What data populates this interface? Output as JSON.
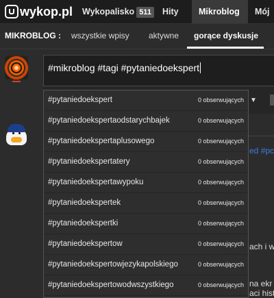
{
  "topbar": {
    "logo_text": "wykop.pl",
    "nav": [
      {
        "label": "Wykopalisko",
        "badge": "511"
      },
      {
        "label": "Hity"
      },
      {
        "label": "Mikroblog"
      },
      {
        "label": "Mój W"
      }
    ]
  },
  "subnav": {
    "label": "MIKROBLOG :",
    "items": [
      "wszystkie wpisy",
      "aktywne",
      "gorące dyskusje"
    ],
    "active": "gorące dyskusje"
  },
  "composer": {
    "value": "#mikroblog #tagi #pytaniedoekspert"
  },
  "suggestions": [
    {
      "tag": "#pytaniedoekspert",
      "count": "0 obserwujących"
    },
    {
      "tag": "#pytaniedoekspertaodstarychbajek",
      "count": "0 obserwujących"
    },
    {
      "tag": "#pytaniedoekspertaplusowego",
      "count": "0 obserwujących"
    },
    {
      "tag": "#pytaniedoekspertatery",
      "count": "0 obserwujących"
    },
    {
      "tag": "#pytaniedoekspertawypoku",
      "count": "0 obserwujących"
    },
    {
      "tag": "#pytaniedoekspertek",
      "count": "0 obserwujących"
    },
    {
      "tag": "#pytaniedoekspertki",
      "count": "0 obserwujących"
    },
    {
      "tag": "#pytaniedoekspertow",
      "count": "0 obserwujących"
    },
    {
      "tag": "#pytaniedoekspertowjezykapolskiego",
      "count": "0 obserwujących"
    },
    {
      "tag": "#pytaniedoekspertowodwszystkiego",
      "count": "0 obserwujących"
    }
  ],
  "background_fragments": {
    "tag_a": "ed",
    "tag_b": " #pcr",
    "text_1": "ach i wi",
    "text_2": "na ekr",
    "text_3": "aci hist"
  }
}
